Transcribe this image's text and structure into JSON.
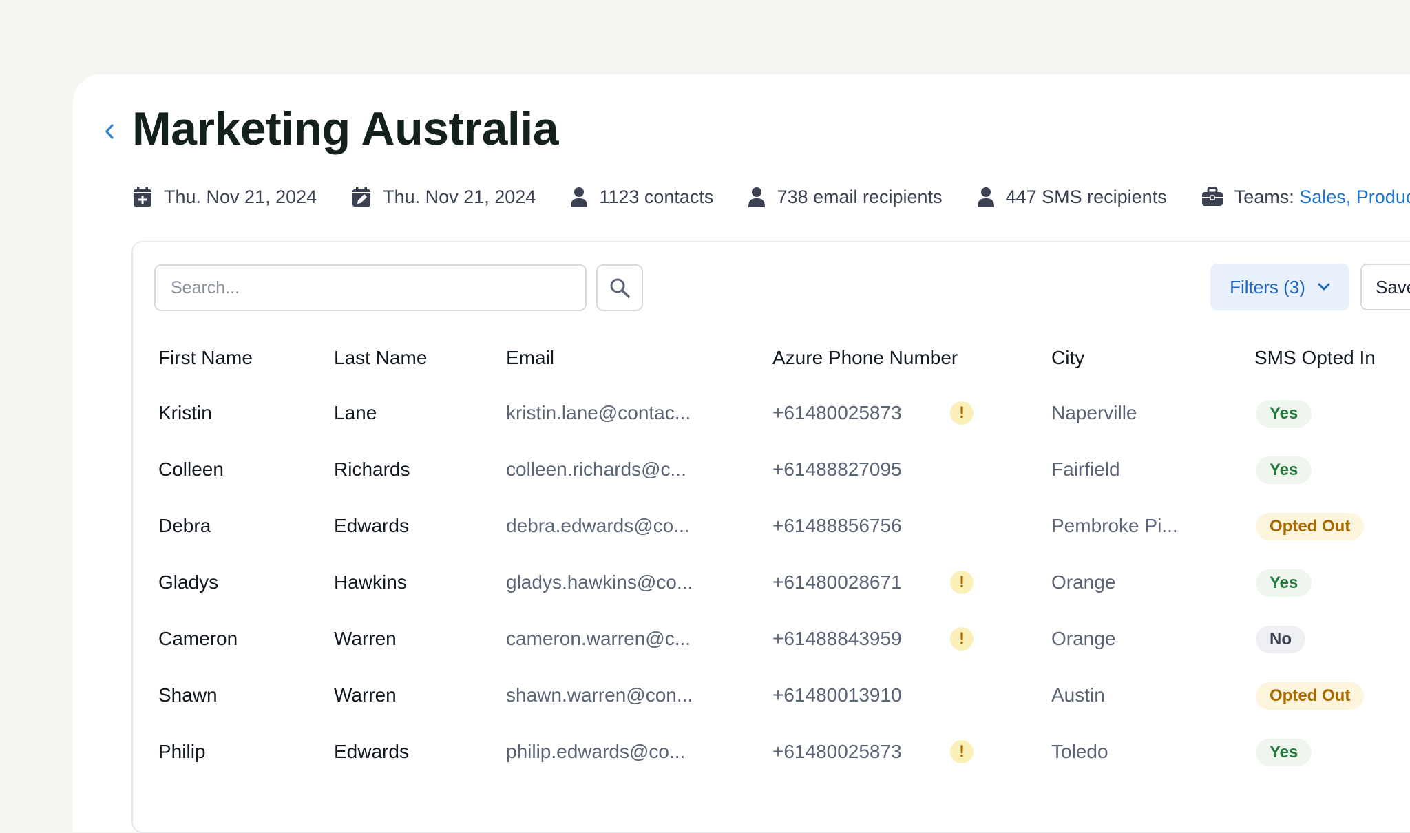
{
  "page": {
    "title": "Marketing Australia"
  },
  "meta": {
    "created_date": "Thu. Nov 21, 2024",
    "modified_date": "Thu. Nov 21, 2024",
    "contacts": "1123 contacts",
    "email_recipients": "738 email recipients",
    "sms_recipients": "447 SMS recipients",
    "teams_label": "Teams:",
    "teams_value": "Sales, Product, +"
  },
  "toolbar": {
    "search_placeholder": "Search...",
    "filters_label": "Filters (3)",
    "save_label": "Save"
  },
  "table": {
    "columns": [
      "First Name",
      "Last Name",
      "Email",
      "Azure Phone Number",
      "City",
      "SMS Opted In"
    ],
    "rows": [
      {
        "first": "Kristin",
        "last": "Lane",
        "email": "kristin.lane@contac...",
        "phone": "+61480025873",
        "warning": true,
        "city": "Naperville",
        "sms": "Yes"
      },
      {
        "first": "Colleen",
        "last": "Richards",
        "email": "colleen.richards@c...",
        "phone": "+61488827095",
        "warning": false,
        "city": "Fairfield",
        "sms": "Yes"
      },
      {
        "first": "Debra",
        "last": "Edwards",
        "email": "debra.edwards@co...",
        "phone": "+61488856756",
        "warning": false,
        "city": "Pembroke Pi...",
        "sms": "Opted Out"
      },
      {
        "first": "Gladys",
        "last": "Hawkins",
        "email": "gladys.hawkins@co...",
        "phone": "+61480028671",
        "warning": true,
        "city": "Orange",
        "sms": "Yes"
      },
      {
        "first": "Cameron",
        "last": "Warren",
        "email": "cameron.warren@c...",
        "phone": "+61488843959",
        "warning": true,
        "city": "Orange",
        "sms": "No"
      },
      {
        "first": "Shawn",
        "last": "Warren",
        "email": "shawn.warren@con...",
        "phone": "+61480013910",
        "warning": false,
        "city": "Austin",
        "sms": "Opted Out"
      },
      {
        "first": "Philip",
        "last": "Edwards",
        "email": "philip.edwards@co...",
        "phone": "+61480025873",
        "warning": true,
        "city": "Toledo",
        "sms": "Yes"
      }
    ],
    "warning_symbol": "!"
  },
  "icons": {
    "back": "chevron-left-icon",
    "created": "calendar-plus-icon",
    "modified": "calendar-edit-icon",
    "person": "person-icon",
    "teams": "briefcase-icon",
    "search": "search-icon",
    "filters": "chevron-down-icon"
  },
  "colors": {
    "accent": "#1f74c9",
    "title": "#14201c",
    "yes_bg": "#eef6ee",
    "yes_fg": "#247a3c",
    "out_bg": "#fdf4dc",
    "out_fg": "#a66a00",
    "no_bg": "#eef0f3",
    "warn_bg": "#fbf0b8"
  }
}
